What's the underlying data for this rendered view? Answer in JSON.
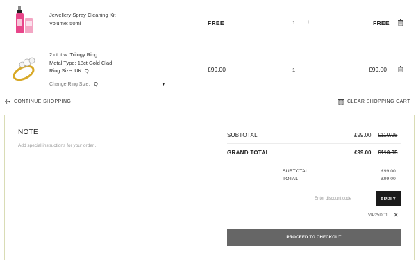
{
  "items": [
    {
      "name": "Jewellery Spray Cleaning Kit",
      "attr1": "Volume: 50ml",
      "price": "FREE",
      "qty": "1",
      "qty_plus": "+",
      "total": "FREE"
    },
    {
      "name": "2 ct. t.w. Trilogy Ring",
      "attr1": "Metal Type: 18ct Gold Clad",
      "attr2": "Ring Size: UK: Q",
      "price": "£99.00",
      "qty": "1",
      "total": "£99.00"
    }
  ],
  "ring_size": {
    "label": "Change Ring Size:",
    "selected": "Q"
  },
  "links": {
    "continue": "CONTINUE SHOPPING",
    "clear": "CLEAR SHOPPING CART"
  },
  "note": {
    "title": "NOTE",
    "placeholder": "Add special instructions for your order..."
  },
  "totals": {
    "subtotal_label": "SUBTOTAL",
    "subtotal_value": "£99.00",
    "subtotal_old": "£110.95",
    "grand_label": "GRAND TOTAL",
    "grand_value": "£99.00",
    "grand_old": "£110.95",
    "small_subtotal_label": "SUBTOTAL",
    "small_subtotal_value": "£99.00",
    "small_total_label": "TOTAL",
    "small_total_value": "£99.00",
    "discount_placeholder": "Enter discount code",
    "apply": "APPLY",
    "applied_code": "VIP25DC1",
    "checkout": "PROCEED TO CHECKOUT"
  }
}
